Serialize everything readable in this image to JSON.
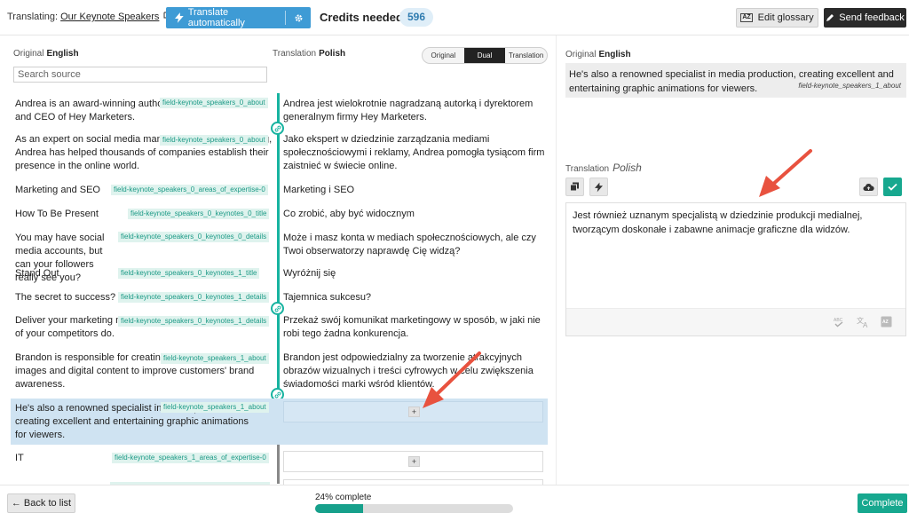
{
  "header": {
    "translating_label": "Translating:",
    "document_link": "Our Keynote Speakers",
    "translate_button": "Translate automatically",
    "credits_label": "Credits needed",
    "credits_value": "596",
    "glossary_button": "Edit glossary",
    "feedback_button": "Send feedback"
  },
  "left_panel": {
    "original_label": "Original",
    "original_lang": "English",
    "translation_label": "Translation",
    "translation_lang": "Polish",
    "view_modes": [
      "Original",
      "Dual",
      "Translation"
    ],
    "active_view": "Dual",
    "search_placeholder": "Search source"
  },
  "rows": [
    {
      "source": "Andrea is an award-winning author and CEO of Hey Marketers.",
      "key": "field-keynote_speakers_0_about",
      "target": "Andrea jest wielokrotnie nagradzaną autorką i dyrektorem generalnym firmy Hey Marketers."
    },
    {
      "source": "As an expert on social media management and advertising, Andrea has helped thousands of companies establish their presence in the online world.",
      "key": "field-keynote_speakers_0_about",
      "target": "Jako ekspert w dziedzinie zarządzania mediami społecznościowymi i reklamy, Andrea pomogła tysiącom firm zaistnieć w świecie online."
    },
    {
      "source": "Marketing and SEO",
      "key": "field-keynote_speakers_0_areas_of_expertise-0",
      "target": "Marketing i SEO"
    },
    {
      "source": "How To Be Present",
      "key": "field-keynote_speakers_0_keynotes_0_title",
      "target": "Co zrobić, aby być widocznym"
    },
    {
      "source": "You may have social media accounts, but can your followers really see you?",
      "key": "field-keynote_speakers_0_keynotes_0_details",
      "target": "Może i masz konta w mediach społecznościowych, ale czy Twoi obserwatorzy naprawdę Cię widzą?"
    },
    {
      "source": "Stand Out",
      "key": "field-keynote_speakers_0_keynotes_1_title",
      "target": "Wyróżnij się"
    },
    {
      "source": "The secret to success?",
      "key": "field-keynote_speakers_0_keynotes_1_details",
      "target": "Tajemnica sukcesu?"
    },
    {
      "source": "Deliver your marketing message in a way none of your competitors do.",
      "key": "field-keynote_speakers_0_keynotes_1_details",
      "target": "Przekaż swój komunikat marketingowy w sposób, w jaki nie robi tego żadna konkurencja."
    },
    {
      "source": "Brandon is responsible for creating engaging visual images and digital content to improve customers' brand awareness.",
      "key": "field-keynote_speakers_1_about",
      "target": "Brandon jest odpowiedzialny za tworzenie atrakcyjnych obrazów wizualnych i treści cyfrowych w celu zwiększenia świadomości marki wśród klientów."
    },
    {
      "source": "He's also a renowned specialist in media production, creating excellent and entertaining graphic animations for viewers.",
      "key": "field-keynote_speakers_1_about",
      "target": ""
    },
    {
      "source": "IT",
      "key": "field-keynote_speakers_1_areas_of_expertise-0",
      "target": ""
    }
  ],
  "editor_panel": {
    "original_label": "Original",
    "original_lang": "English",
    "original_text": "He's also a renowned specialist in media production, creating excellent and entertaining graphic animations for viewers.",
    "original_key": "field-keynote_speakers_1_about",
    "translation_label": "Translation",
    "translation_lang": "Polish",
    "translation_text": "Jest również uznanym specjalistą w dziedzinie produkcji medialnej, tworzącym doskonałe i zabawne animacje graficzne dla widzów."
  },
  "footer": {
    "back_button": "← Back to list",
    "progress_label": "24% complete",
    "progress_value": 0.24,
    "complete_button": "Complete"
  },
  "colors": {
    "accent_blue": "#3e9bd5",
    "accent_green": "#17a88f",
    "arrow_red": "#e8523f"
  }
}
